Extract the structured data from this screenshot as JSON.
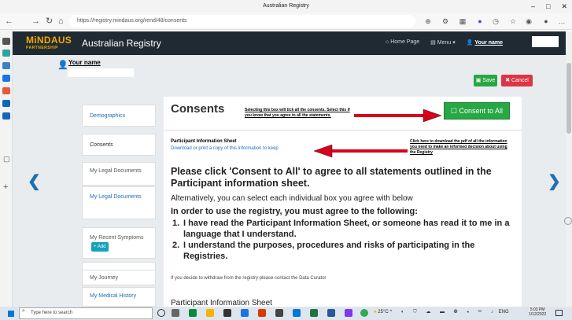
{
  "browser": {
    "title": "Australian Registry",
    "url": "https://registry.mindaus.org/rend/48/consents",
    "window_controls": {
      "minimize": "–",
      "maximize": "□",
      "close": "✕"
    }
  },
  "app": {
    "logo_text": "MiNDAUS",
    "logo_sub": "PARTNERSHIP",
    "title": "Australian Registry",
    "nav": {
      "home": "Home Page",
      "menu": "Menu",
      "user": "Your name"
    }
  },
  "user": {
    "name": "Your name"
  },
  "actions": {
    "save": "Save",
    "cancel": "Cancel"
  },
  "sidebar": {
    "items": [
      {
        "label": "Demographics"
      },
      {
        "label": "Consents"
      },
      {
        "label": "My Legal Documents"
      },
      {
        "label": "My Legal Documents"
      },
      {
        "label": "My Recent Symptoms",
        "badge": "+ Add"
      },
      {
        "label": "My Journey"
      },
      {
        "label": "My Medical History"
      }
    ]
  },
  "main": {
    "title": "Consents",
    "consent_button": "Consent to All",
    "annotation_consent": "Selecting this box will tick all the consents. Select this if you know that you agree to all the statements.",
    "pis_label": "Participant Information Sheet",
    "pis_link": "Download or print a copy of this information to keep",
    "annotation_download": "Click here to download the pdf of all the information you need to make an informed decision about using the Registry",
    "headline": "Please click 'Consent to All' to agree to all statements outlined in the Participant information sheet.",
    "alternative": "Alternatively, you can select each individual box you agree with below",
    "requirement_heading": "In order to use the registry, you must agree to the following:",
    "requirements": [
      {
        "num": "1.",
        "text": "I have read the Participant Information Sheet, or someone has read it to me in a language that I understand."
      },
      {
        "num": "2.",
        "text": "I understand the purposes, procedures and risks of participating in the Registries."
      }
    ],
    "withdraw": "If you decide to withdraw from the registry please contact the Data Curator",
    "section_title": "Participant Information Sheet"
  },
  "taskbar": {
    "search_placeholder": "Type here to search",
    "temperature": "25°C",
    "lang": "ENG",
    "time": "5:03 PM",
    "date": "1/12/2022"
  },
  "colors": {
    "navbar": "#1f2a33",
    "accent": "#1f6fb2",
    "success": "#28a745",
    "danger": "#dc3545",
    "arrow": "#d9001b"
  }
}
